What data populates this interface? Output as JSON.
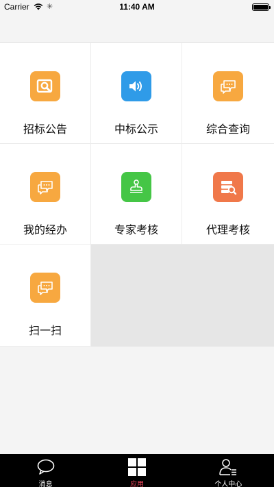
{
  "status_bar": {
    "carrier": "Carrier",
    "time": "11:40 AM",
    "wifi_icon": "wifi-icon",
    "activity_icon": "activity-spinner-icon",
    "battery_icon": "battery-icon"
  },
  "grid": {
    "items": [
      {
        "label": "招标公告",
        "icon": "search-document-icon",
        "color": "#f7a840"
      },
      {
        "label": "中标公示",
        "icon": "speaker-icon",
        "color": "#2f9be8"
      },
      {
        "label": "综合查询",
        "icon": "chat-bubbles-icon",
        "color": "#f7a840"
      },
      {
        "label": "我的经办",
        "icon": "chat-bubbles-icon",
        "color": "#f7a840"
      },
      {
        "label": "专家考核",
        "icon": "stamp-icon",
        "color": "#45c646"
      },
      {
        "label": "代理考核",
        "icon": "database-search-icon",
        "color": "#f0784a"
      },
      {
        "label": "扫一扫",
        "icon": "chat-bubbles-icon",
        "color": "#f7a840"
      }
    ]
  },
  "tabbar": {
    "tabs": [
      {
        "label": "消息",
        "icon": "message-bubble-icon",
        "active": false
      },
      {
        "label": "应用",
        "icon": "grid-apps-icon",
        "active": true
      },
      {
        "label": "个人中心",
        "icon": "user-profile-icon",
        "active": false
      }
    ],
    "active_color": "#e8445a"
  }
}
